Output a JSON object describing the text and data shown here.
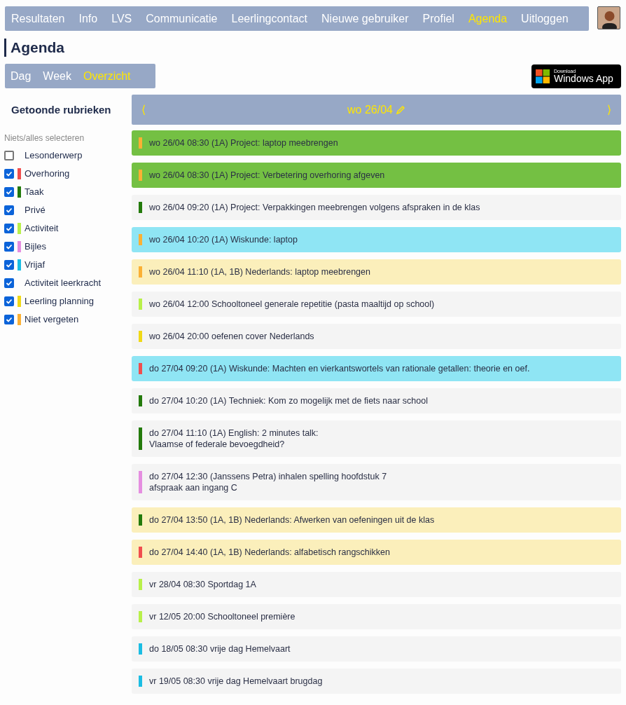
{
  "nav": {
    "items": [
      {
        "label": "Resultaten",
        "selected": false
      },
      {
        "label": "Info",
        "selected": false
      },
      {
        "label": "LVS",
        "selected": false
      },
      {
        "label": "Communicatie",
        "selected": false
      },
      {
        "label": "Leerlingcontact",
        "selected": false
      },
      {
        "label": "Nieuwe gebruiker",
        "selected": false
      },
      {
        "label": "Profiel",
        "selected": false
      },
      {
        "label": "Agenda",
        "selected": true
      },
      {
        "label": "Uitloggen",
        "selected": false
      }
    ]
  },
  "title": "Agenda",
  "views": [
    {
      "label": "Dag",
      "selected": false
    },
    {
      "label": "Week",
      "selected": false
    },
    {
      "label": "Overzicht",
      "selected": true
    }
  ],
  "app_badge": {
    "small": "Download",
    "large": "Windows App"
  },
  "sidebar": {
    "heading": "Getoonde rubrieken",
    "select_all": "Niets/alles selecteren",
    "categories": [
      {
        "label": "Lesonderwerp",
        "checked": false
      },
      {
        "label": "Overhoring",
        "checked": true,
        "color": "#f04e4e"
      },
      {
        "label": "Taak",
        "checked": true,
        "color": "#237a0b"
      },
      {
        "label": "Privé",
        "checked": true
      },
      {
        "label": "Activiteit",
        "checked": true,
        "color": "#b8f04a"
      },
      {
        "label": "Bijles",
        "checked": true,
        "color": "#e58ee0"
      },
      {
        "label": "Vrijaf",
        "checked": true,
        "color": "#1bbde3"
      },
      {
        "label": "Activiteit leerkracht",
        "checked": true
      },
      {
        "label": "Leerling planning",
        "checked": true,
        "color": "#f0d916"
      },
      {
        "label": "Niet vergeten",
        "checked": true,
        "color": "#fbb034"
      }
    ]
  },
  "date_bar": {
    "prev": "⟨",
    "date": "wo 26/04",
    "next": "⟩"
  },
  "events": [
    {
      "kind": "green",
      "color": "#fbb034",
      "lines": [
        "wo 26/04 08:30 (1A) Project: laptop meebrengen"
      ]
    },
    {
      "kind": "green",
      "color": "#fbb034",
      "lines": [
        "wo 26/04 08:30 (1A) Project: Verbetering overhoring afgeven"
      ]
    },
    {
      "kind": "plain",
      "color": "#237a0b",
      "lines": [
        "wo 26/04 09:20 (1A) Project: Verpakkingen meebrengen volgens afspraken in de klas"
      ]
    },
    {
      "kind": "cyan",
      "color": "#fbb034",
      "lines": [
        "wo 26/04 10:20 (1A) Wiskunde: laptop"
      ]
    },
    {
      "kind": "yellow",
      "color": "#fbb034",
      "lines": [
        "wo 26/04 11:10 (1A, 1B) Nederlands: laptop meebrengen"
      ]
    },
    {
      "kind": "plain",
      "color": "#b8f04a",
      "lines": [
        "wo 26/04 12:00 Schooltoneel generale repetitie (pasta maaltijd op school)"
      ]
    },
    {
      "kind": "plain",
      "color": "#f0d916",
      "lines": [
        "wo 26/04 20:00 oefenen cover Nederlands"
      ]
    },
    {
      "kind": "cyan",
      "color": "#f04e4e",
      "lines": [
        "do 27/04 09:20 (1A) Wiskunde: Machten en vierkantswortels van rationale getallen: theorie en oef."
      ]
    },
    {
      "kind": "plain",
      "color": "#237a0b",
      "lines": [
        "do 27/04 10:20 (1A) Techniek: Kom zo mogelijk met de fiets naar school"
      ]
    },
    {
      "kind": "plain",
      "color": "#237a0b",
      "lines": [
        "do 27/04 11:10 (1A) English: 2 minutes talk:",
        "Vlaamse of federale bevoegdheid?"
      ]
    },
    {
      "kind": "plain",
      "color": "#e58ee0",
      "lines": [
        "do 27/04 12:30 (Janssens Petra) inhalen spelling hoofdstuk 7",
        "afspraak aan ingang C"
      ]
    },
    {
      "kind": "yellow",
      "color": "#237a0b",
      "lines": [
        "do 27/04 13:50 (1A, 1B) Nederlands: Afwerken van oefeningen uit de klas"
      ]
    },
    {
      "kind": "yellow",
      "color": "#f04e4e",
      "lines": [
        "do 27/04 14:40 (1A, 1B) Nederlands: alfabetisch rangschikken"
      ]
    },
    {
      "kind": "plain",
      "color": "#b8f04a",
      "lines": [
        "vr 28/04 08:30 Sportdag 1A"
      ]
    },
    {
      "kind": "plain",
      "color": "#b8f04a",
      "lines": [
        "vr 12/05 20:00 Schooltoneel première"
      ]
    },
    {
      "kind": "plain",
      "color": "#1bbde3",
      "lines": [
        "do 18/05 08:30 vrije dag Hemelvaart"
      ]
    },
    {
      "kind": "plain",
      "color": "#1bbde3",
      "lines": [
        "vr 19/05 08:30 vrije dag Hemelvaart brugdag"
      ]
    }
  ]
}
